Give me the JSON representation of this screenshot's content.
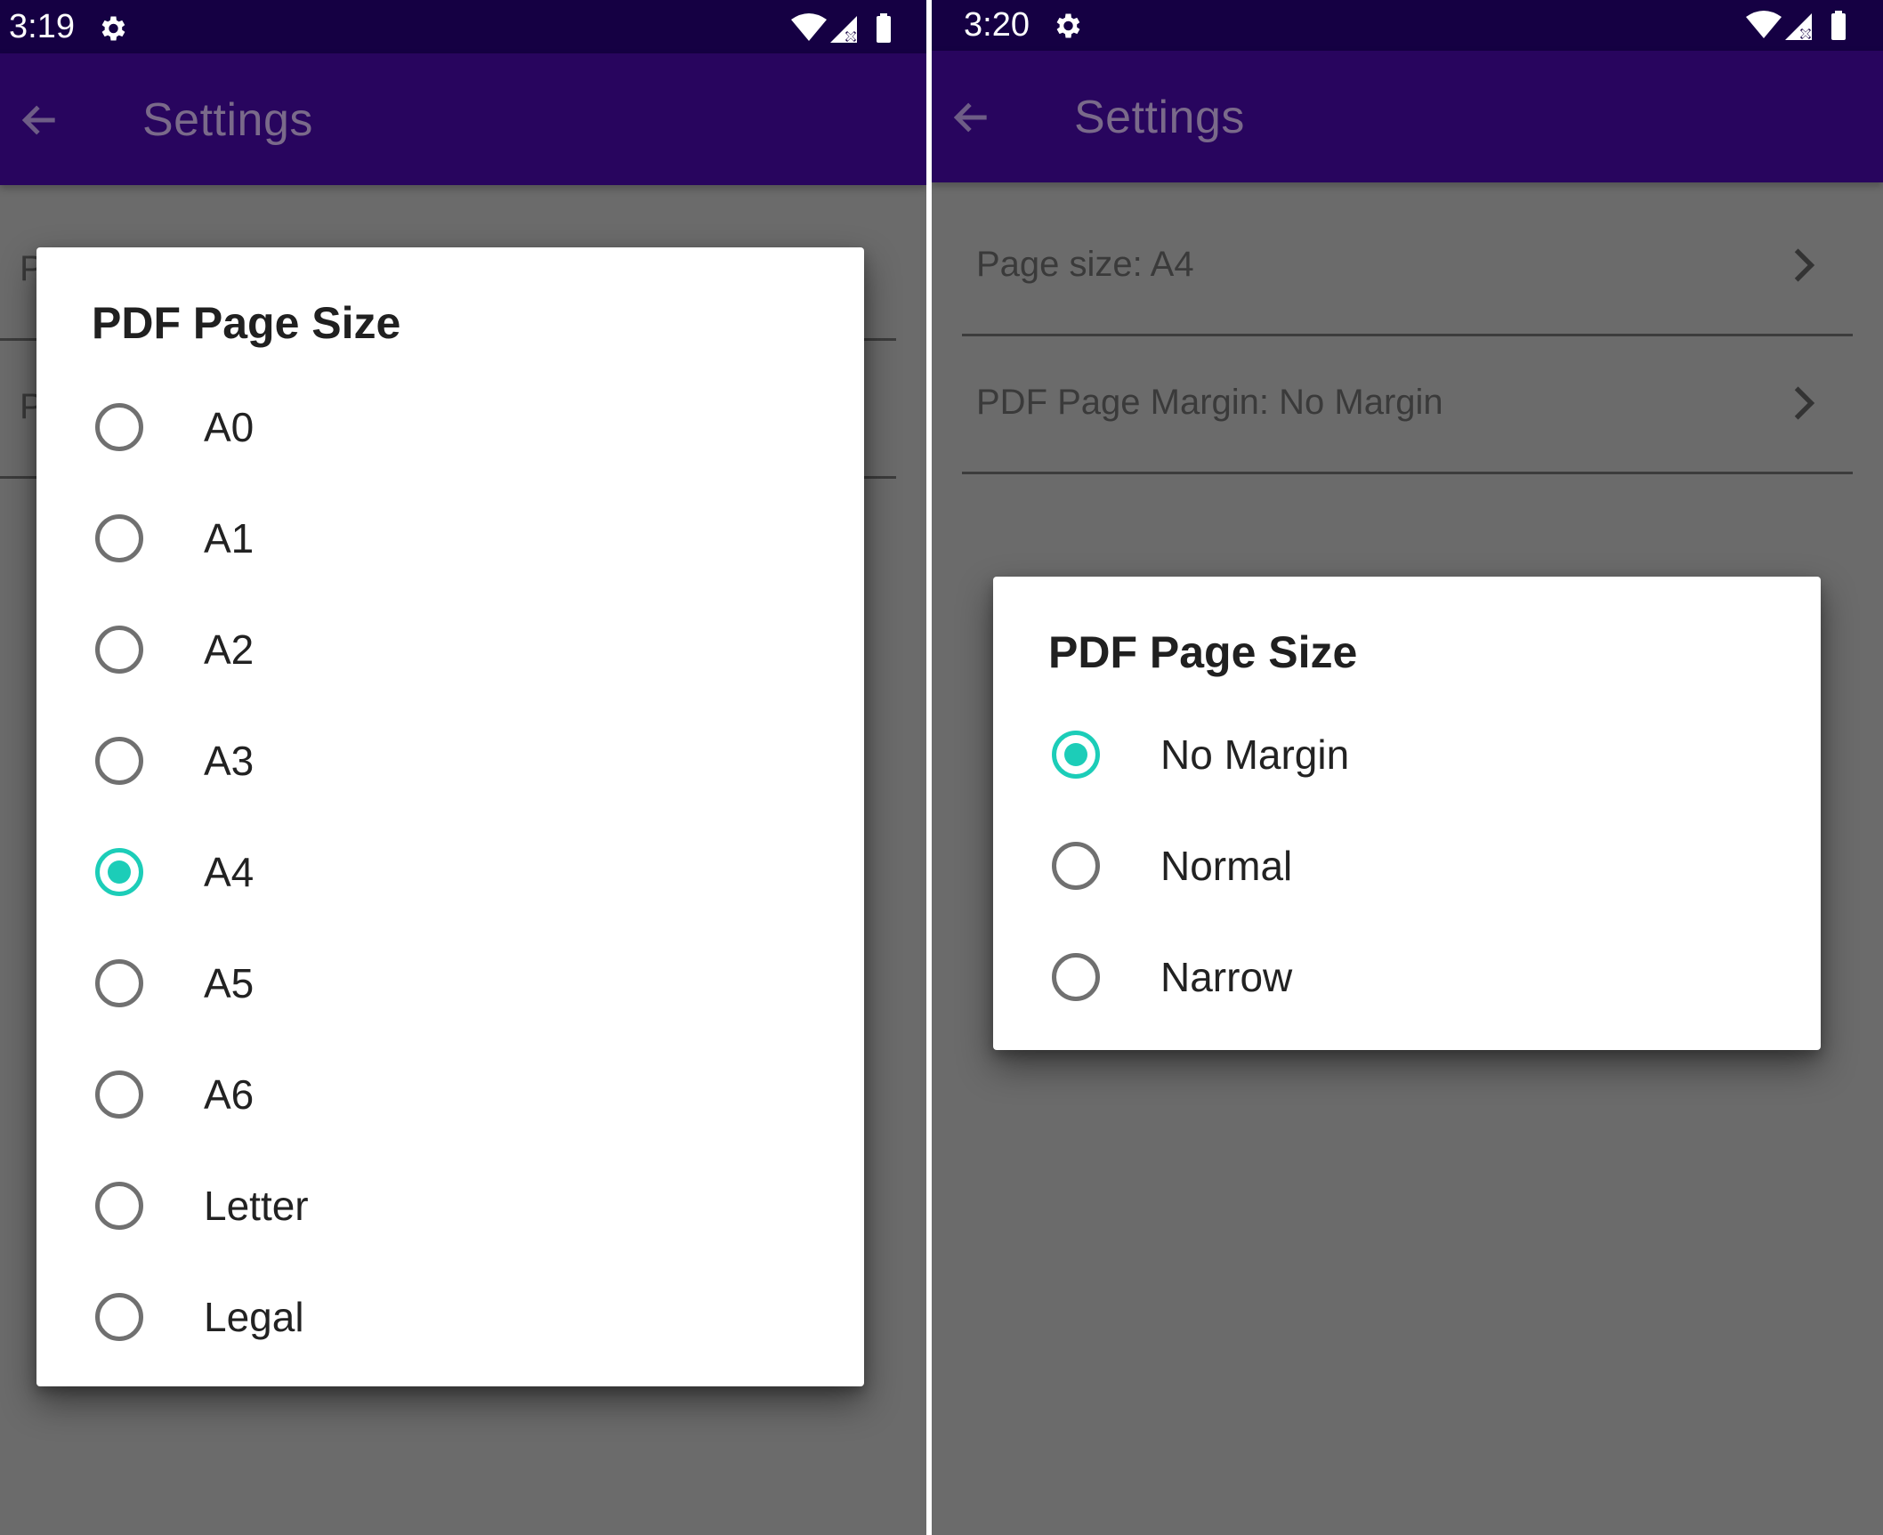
{
  "left_screen": {
    "status_bar": {
      "time": "3:19"
    },
    "app_bar": {
      "title": "Settings"
    },
    "background_rows": [
      {
        "label": "P"
      },
      {
        "label": "P"
      }
    ],
    "dialog": {
      "title": "PDF Page Size",
      "options": [
        {
          "label": "A0",
          "checked": false
        },
        {
          "label": "A1",
          "checked": false
        },
        {
          "label": "A2",
          "checked": false
        },
        {
          "label": "A3",
          "checked": false
        },
        {
          "label": "A4",
          "checked": true
        },
        {
          "label": "A5",
          "checked": false
        },
        {
          "label": "A6",
          "checked": false
        },
        {
          "label": "Letter",
          "checked": false
        },
        {
          "label": "Legal",
          "checked": false
        }
      ]
    }
  },
  "right_screen": {
    "status_bar": {
      "time": "3:20"
    },
    "app_bar": {
      "title": "Settings"
    },
    "settings": [
      {
        "label": "Page size: A4"
      },
      {
        "label": "PDF Page Margin: No Margin"
      }
    ],
    "dialog": {
      "title": "PDF Page Size",
      "options": [
        {
          "label": "No Margin",
          "checked": true
        },
        {
          "label": "Normal",
          "checked": false
        },
        {
          "label": "Narrow",
          "checked": false
        }
      ]
    }
  },
  "colors": {
    "status_bar": "#150043",
    "app_bar": "#28055e",
    "scrim_background": "#6b6b6b",
    "accent_radio": "#1ccdb8",
    "unchecked_radio": "#707070"
  },
  "icons": {
    "status_gear": "gear-icon",
    "wifi": "wifi-icon",
    "signal": "signal-icon",
    "battery": "battery-icon",
    "back": "arrow-back-icon",
    "chevron": "chevron-right-icon"
  }
}
